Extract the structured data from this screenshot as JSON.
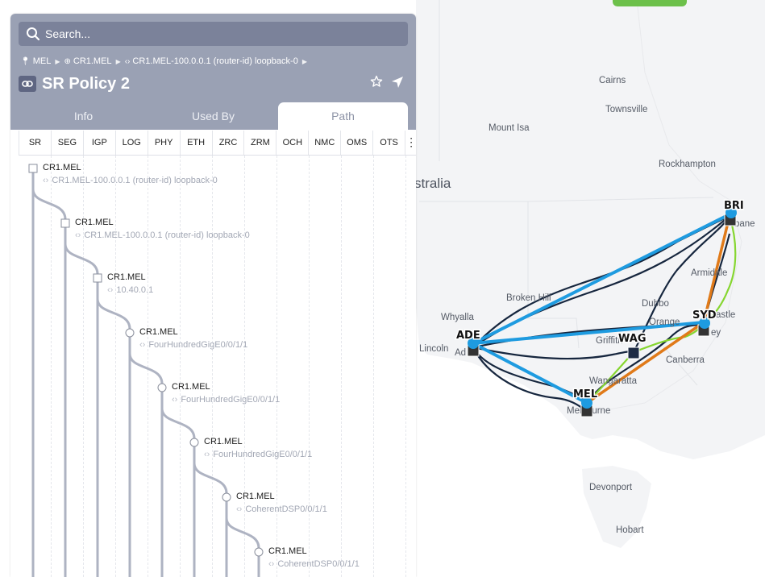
{
  "map": {
    "region_label": "stralia",
    "places": [
      {
        "name": "Cairns"
      },
      {
        "name": "Townsville"
      },
      {
        "name": "Mount Isa"
      },
      {
        "name": "Rockhampton"
      },
      {
        "name": "Armidale"
      },
      {
        "name": "Broken Hill"
      },
      {
        "name": "Whyalla"
      },
      {
        "name": "Dubbo"
      },
      {
        "name": "Orange"
      },
      {
        "name": "Griffith"
      },
      {
        "name": "Canberra"
      },
      {
        "name": "Wangaratta"
      },
      {
        "name": "Lincoln"
      },
      {
        "name": "Ad"
      },
      {
        "name": "Melbourne"
      },
      {
        "name": "Devonport"
      },
      {
        "name": "Hobart"
      },
      {
        "name": "astle"
      },
      {
        "name": "ey"
      },
      {
        "name": "bane"
      }
    ],
    "nodes": [
      {
        "label": "BRI"
      },
      {
        "label": "SYD"
      },
      {
        "label": "ADE"
      },
      {
        "label": "WAG"
      },
      {
        "label": "MEL"
      }
    ],
    "colors": {
      "sr_path": "#1e9be0",
      "optical_path": "#e07a19",
      "fiber": "#16263e",
      "green_link": "#86d630",
      "node": "#1e9be0"
    }
  },
  "panel": {
    "search_placeholder": "Search...",
    "breadcrumb": [
      "MEL",
      "CR1.MEL",
      "CR1.MEL-100.0.0.1 (router-id) loopback-0"
    ],
    "title": "SR Policy 2",
    "tabs": [
      "Info",
      "Used By",
      "Path"
    ],
    "active_tab": "Path",
    "layers": [
      "SR",
      "SEG",
      "IGP",
      "LOG",
      "PHY",
      "ETH",
      "ZRC",
      "ZRM",
      "OCH",
      "NMC",
      "OMS",
      "OTS"
    ],
    "hops": [
      {
        "name": "CR1.MEL",
        "detail": "CR1.MEL-100.0.0.1 (router-id) loopback-0"
      },
      {
        "name": "CR1.MEL",
        "detail": "CR1.MEL-100.0.0.1 (router-id) loopback-0"
      },
      {
        "name": "CR1.MEL",
        "detail": "10.40.0.1"
      },
      {
        "name": "CR1.MEL",
        "detail": "FourHundredGigE0/0/1/1"
      },
      {
        "name": "CR1.MEL",
        "detail": "FourHundredGigE0/0/1/1"
      },
      {
        "name": "CR1.MEL",
        "detail": "FourHundredGigE0/0/1/1"
      },
      {
        "name": "CR1.MEL",
        "detail": "CoherentDSP0/0/1/1"
      },
      {
        "name": "CR1.MEL",
        "detail": "CoherentDSP0/0/1/1"
      }
    ]
  }
}
